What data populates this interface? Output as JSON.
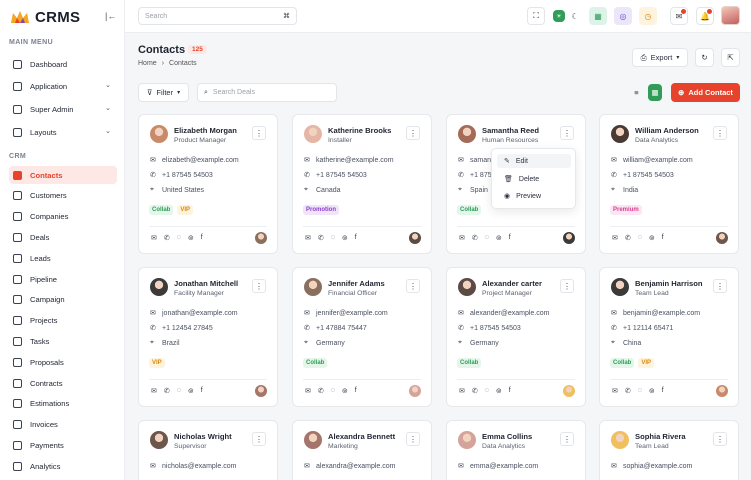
{
  "brand": {
    "name": "CRMS"
  },
  "sidebar": {
    "main_menu_title": "MAIN MENU",
    "main_items": [
      {
        "label": "Dashboard",
        "has_chevron": false
      },
      {
        "label": "Application",
        "has_chevron": true
      },
      {
        "label": "Super Admin",
        "has_chevron": true
      },
      {
        "label": "Layouts",
        "has_chevron": true
      }
    ],
    "crm_title": "CRM",
    "crm_items": [
      "Contacts",
      "Customers",
      "Companies",
      "Deals",
      "Leads",
      "Pipeline",
      "Campaign",
      "Projects",
      "Tasks",
      "Proposals",
      "Contracts",
      "Estimations",
      "Invoices",
      "Payments",
      "Analytics"
    ],
    "active_item": "Contacts"
  },
  "topbar": {
    "search_placeholder": "Search",
    "search_shortcut": "⌘"
  },
  "page": {
    "title": "Contacts",
    "count": "125",
    "breadcrumb": [
      "Home",
      "Contacts"
    ],
    "export_label": "Export"
  },
  "toolbar": {
    "filter_label": "Filter",
    "search_placeholder": "Search Deals",
    "add_label": "Add Contact"
  },
  "colors": {
    "accent": "#e7422b"
  },
  "contacts": [
    {
      "name": "Elizabeth Morgan",
      "role": "Product Manager",
      "email": "elizabeth@example.com",
      "phone": "+1 87545 54503",
      "location": "United States",
      "tags": [
        "Collab",
        "VIP"
      ]
    },
    {
      "name": "Katherine Brooks",
      "role": "Installer",
      "email": "katherine@example.com",
      "phone": "+1 87545 54503",
      "location": "Canada",
      "tags": [
        "Promotion"
      ]
    },
    {
      "name": "Samantha Reed",
      "role": "Human Resources",
      "email": "samantha@example.com",
      "phone": "+1 87545 54503",
      "location": "Spain",
      "tags": [
        "Collab"
      ]
    },
    {
      "name": "William Anderson",
      "role": "Data Analytics",
      "email": "william@example.com",
      "phone": "+1 87545 54503",
      "location": "India",
      "tags": [
        "Premium"
      ]
    },
    {
      "name": "Jonathan Mitchell",
      "role": "Facility Manager",
      "email": "jonathan@example.com",
      "phone": "+1 12454 27845",
      "location": "Brazil",
      "tags": [
        "VIP"
      ]
    },
    {
      "name": "Jennifer Adams",
      "role": "Financial Officer",
      "email": "jennifer@example.com",
      "phone": "+1 47884 75447",
      "location": "Germany",
      "tags": [
        "Collab"
      ]
    },
    {
      "name": "Alexander carter",
      "role": "Project Manager",
      "email": "alexander@example.com",
      "phone": "+1 87545 54503",
      "location": "Germany",
      "tags": [
        "Collab"
      ]
    },
    {
      "name": "Benjamin Harrison",
      "role": "Team Lead",
      "email": "benjamin@example.com",
      "phone": "+1 12114 65471",
      "location": "China",
      "tags": [
        "Collab",
        "VIP"
      ]
    },
    {
      "name": "Nicholas Wright",
      "role": "Supervisor",
      "email": "nicholas@example.com",
      "phone": "",
      "location": "",
      "tags": []
    },
    {
      "name": "Alexandra Bennett",
      "role": "Marketing",
      "email": "alexandra@example.com",
      "phone": "",
      "location": "",
      "tags": []
    },
    {
      "name": "Emma Collins",
      "role": "Data Analytics",
      "email": "emma@example.com",
      "phone": "",
      "location": "",
      "tags": []
    },
    {
      "name": "Sophia Rivera",
      "role": "Team Lead",
      "email": "sophia@example.com",
      "phone": "",
      "location": "",
      "tags": []
    }
  ],
  "dropdown": {
    "items": [
      "Edit",
      "Delete",
      "Preview"
    ],
    "highlighted": "Edit"
  }
}
